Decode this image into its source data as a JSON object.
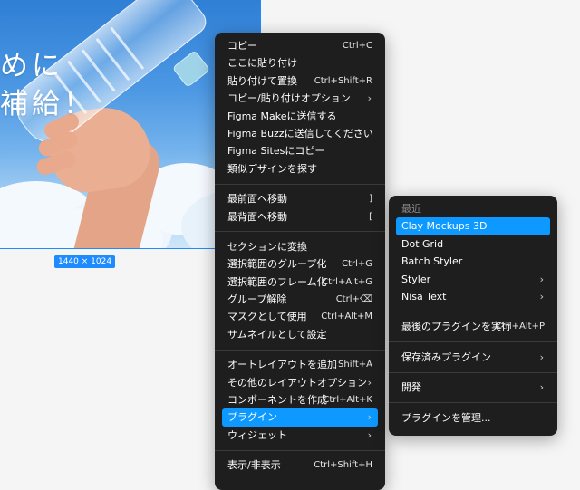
{
  "canvas": {
    "headline_line1": "めに",
    "headline_line2": "補給！",
    "size_badge": "1440 × 1024"
  },
  "context_menu": {
    "groups": [
      [
        {
          "label": "コピー",
          "shortcut": "Ctrl+C"
        },
        {
          "label": "ここに貼り付け",
          "shortcut": ""
        },
        {
          "label": "貼り付けて置換",
          "shortcut": "Ctrl+Shift+R"
        },
        {
          "label": "コピー/貼り付けオプション",
          "shortcut": "›"
        },
        {
          "label": "Figma Makeに送信する",
          "shortcut": ""
        },
        {
          "label": "Figma Buzzに送信してください",
          "shortcut": ""
        },
        {
          "label": "Figma Sitesにコピー",
          "shortcut": ""
        },
        {
          "label": "類似デザインを探す",
          "shortcut": ""
        }
      ],
      [
        {
          "label": "最前面へ移動",
          "shortcut": "]"
        },
        {
          "label": "最背面へ移動",
          "shortcut": "["
        }
      ],
      [
        {
          "label": "セクションに変換",
          "shortcut": ""
        },
        {
          "label": "選択範囲のグループ化",
          "shortcut": "Ctrl+G"
        },
        {
          "label": "選択範囲のフレーム化",
          "shortcut": "Ctrl+Alt+G"
        },
        {
          "label": "グループ解除",
          "shortcut": "Ctrl+⌫"
        },
        {
          "label": "マスクとして使用",
          "shortcut": "Ctrl+Alt+M"
        },
        {
          "label": "サムネイルとして設定",
          "shortcut": ""
        }
      ],
      [
        {
          "label": "オートレイアウトを追加",
          "shortcut": "Shift+A"
        },
        {
          "label": "その他のレイアウトオプション",
          "shortcut": "›"
        },
        {
          "label": "コンポーネントを作成",
          "shortcut": "Ctrl+Alt+K"
        },
        {
          "label": "プラグイン",
          "shortcut": "›"
        },
        {
          "label": "ウィジェット",
          "shortcut": "›"
        }
      ],
      [
        {
          "label": "表示/非表示",
          "shortcut": "Ctrl+Shift+H"
        }
      ]
    ]
  },
  "plugins_submenu": {
    "recent_header": "最近",
    "recent": [
      {
        "label": "Clay Mockups 3D",
        "shortcut": ""
      },
      {
        "label": "Dot Grid",
        "shortcut": ""
      },
      {
        "label": "Batch Styler",
        "shortcut": ""
      },
      {
        "label": "Styler",
        "shortcut": "›"
      },
      {
        "label": "Nisa Text",
        "shortcut": "›"
      }
    ],
    "run_last": {
      "label": "最後のプラグインを実行",
      "shortcut": "Ctrl+Alt+P"
    },
    "saved": {
      "label": "保存済みプラグイン",
      "shortcut": "›"
    },
    "development": {
      "label": "開発",
      "shortcut": "›"
    },
    "manage": {
      "label": "プラグインを管理...",
      "shortcut": ""
    }
  },
  "colors": {
    "menu_bg": "#1e1e1e",
    "accent": "#0d99ff",
    "selection": "#1e8bff"
  }
}
